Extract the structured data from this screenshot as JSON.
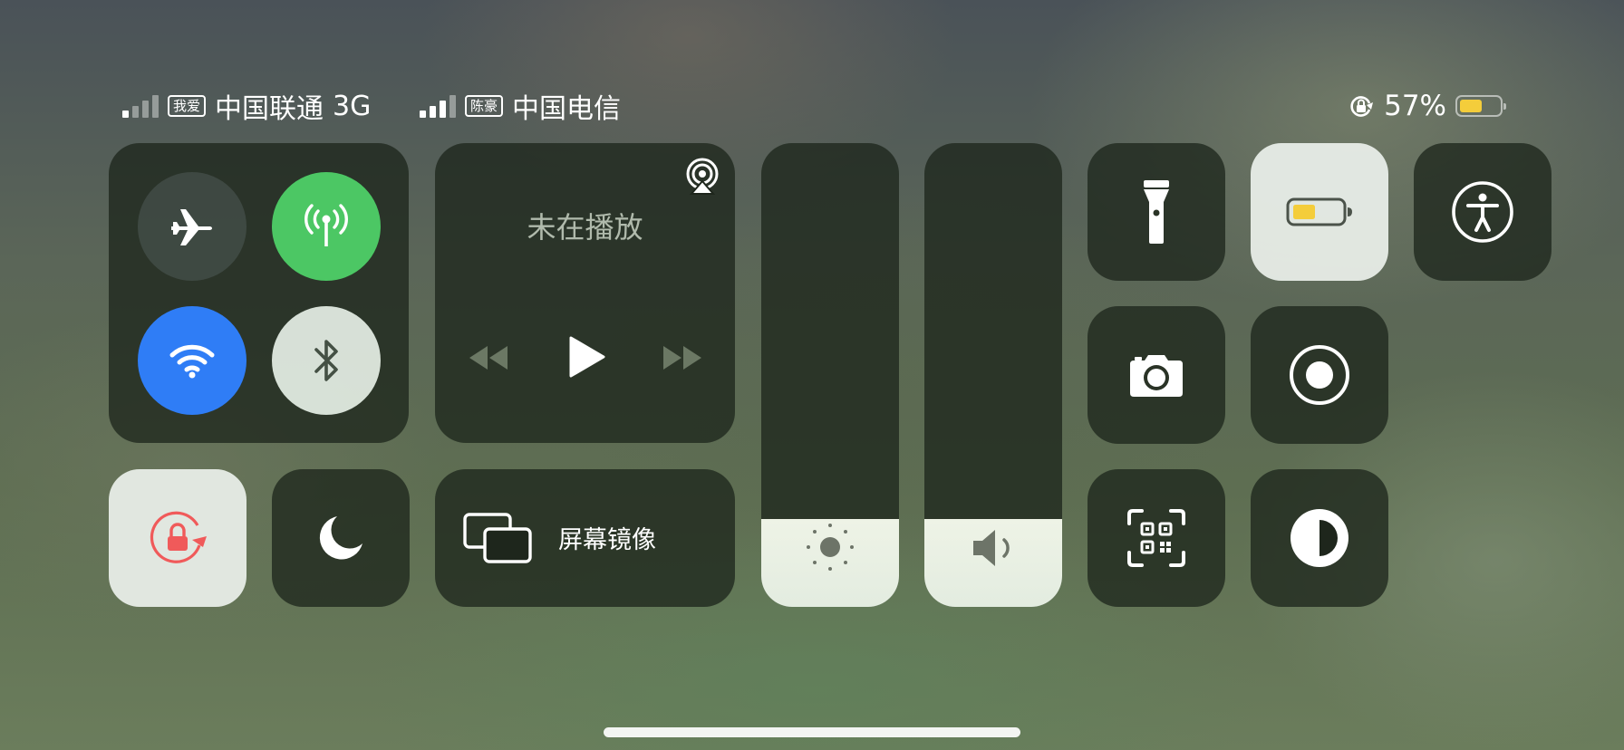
{
  "status_bar": {
    "sim1": {
      "tag": "我爱",
      "carrier": "中国联通",
      "network": "3G",
      "signal_bars": 1
    },
    "sim2": {
      "tag": "陈豪",
      "carrier": "中国电信",
      "signal_bars": 3
    },
    "battery_percent": "57%",
    "battery_level": 0.57,
    "battery_color": "#f4cd3b"
  },
  "connectivity": {
    "airplane": {
      "icon": "airplane-icon",
      "active": false
    },
    "cellular": {
      "icon": "antenna-icon",
      "active": true,
      "color": "#4cc764"
    },
    "wifi": {
      "icon": "wifi-icon",
      "active": true,
      "color": "#2f7df6"
    },
    "bluetooth": {
      "icon": "bluetooth-icon",
      "active": false
    }
  },
  "media": {
    "now_playing": "未在播放",
    "airplay_icon": "airplay-icon"
  },
  "sliders": {
    "brightness": {
      "icon": "sun-icon",
      "level": 0.19
    },
    "volume": {
      "icon": "speaker-icon",
      "level": 0.19
    }
  },
  "screen_mirroring": {
    "label": "屏幕镜像",
    "icon": "screen-mirroring-icon"
  },
  "orientation_lock": {
    "icon": "orientation-lock-icon",
    "active": true,
    "color": "#f05a5a"
  },
  "do_not_disturb": {
    "icon": "moon-icon"
  },
  "tiles": {
    "flashlight": "flashlight-icon",
    "low_power": "battery-icon",
    "accessibility": "accessibility-icon",
    "camera": "camera-icon",
    "screen_recording": "record-icon",
    "qr_scanner": "qr-code-icon",
    "dark_mode": "dark-mode-icon"
  }
}
